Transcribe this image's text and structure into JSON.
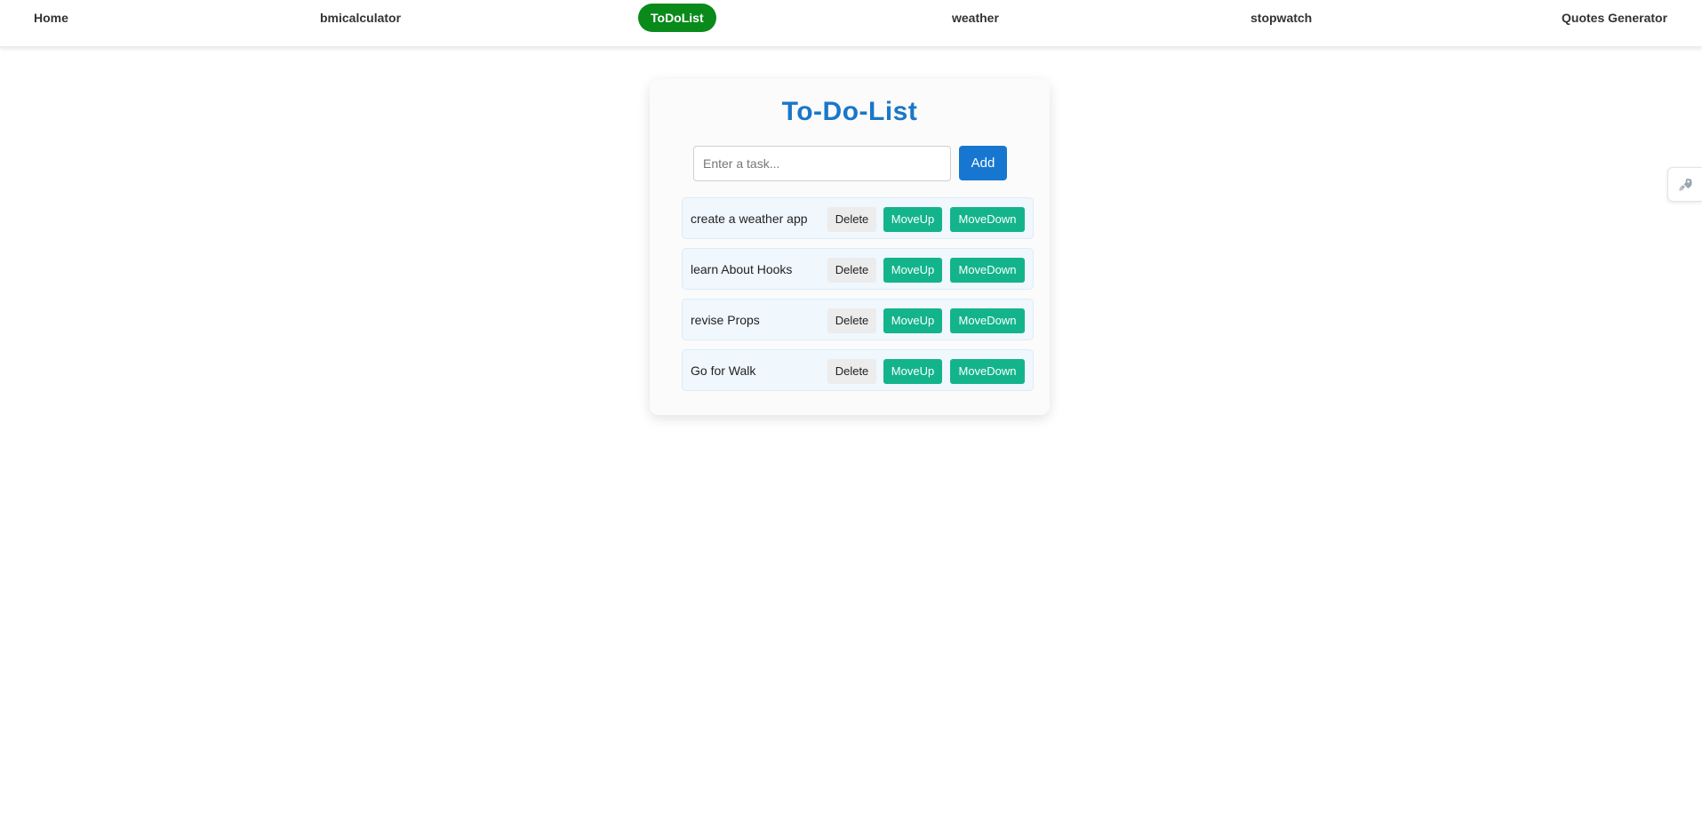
{
  "navbar": {
    "items": [
      {
        "label": "Home",
        "active": false
      },
      {
        "label": "bmicalculator",
        "active": false
      },
      {
        "label": "ToDoList",
        "active": true
      },
      {
        "label": "weather",
        "active": false
      },
      {
        "label": "stopwatch",
        "active": false
      },
      {
        "label": "Quotes Generator",
        "active": false
      }
    ],
    "active_color": "#098a1a"
  },
  "todo": {
    "title": "To-Do-List",
    "input": {
      "placeholder": "Enter a task...",
      "value": ""
    },
    "add_label": "Add",
    "buttons": {
      "delete_label": "Delete",
      "move_up_label": "MoveUp",
      "move_down_label": "MoveDown"
    },
    "tasks": [
      {
        "text": "create a weather app"
      },
      {
        "text": "learn About Hooks"
      },
      {
        "text": "revise Props"
      },
      {
        "text": "Go for Walk"
      }
    ]
  },
  "side_widget": {
    "icon": "rocket-icon"
  },
  "colors": {
    "title": "#1977c9",
    "add_button": "#1777d0",
    "move_buttons": "#13b48b",
    "task_row_bg": "#f0f7fd"
  }
}
